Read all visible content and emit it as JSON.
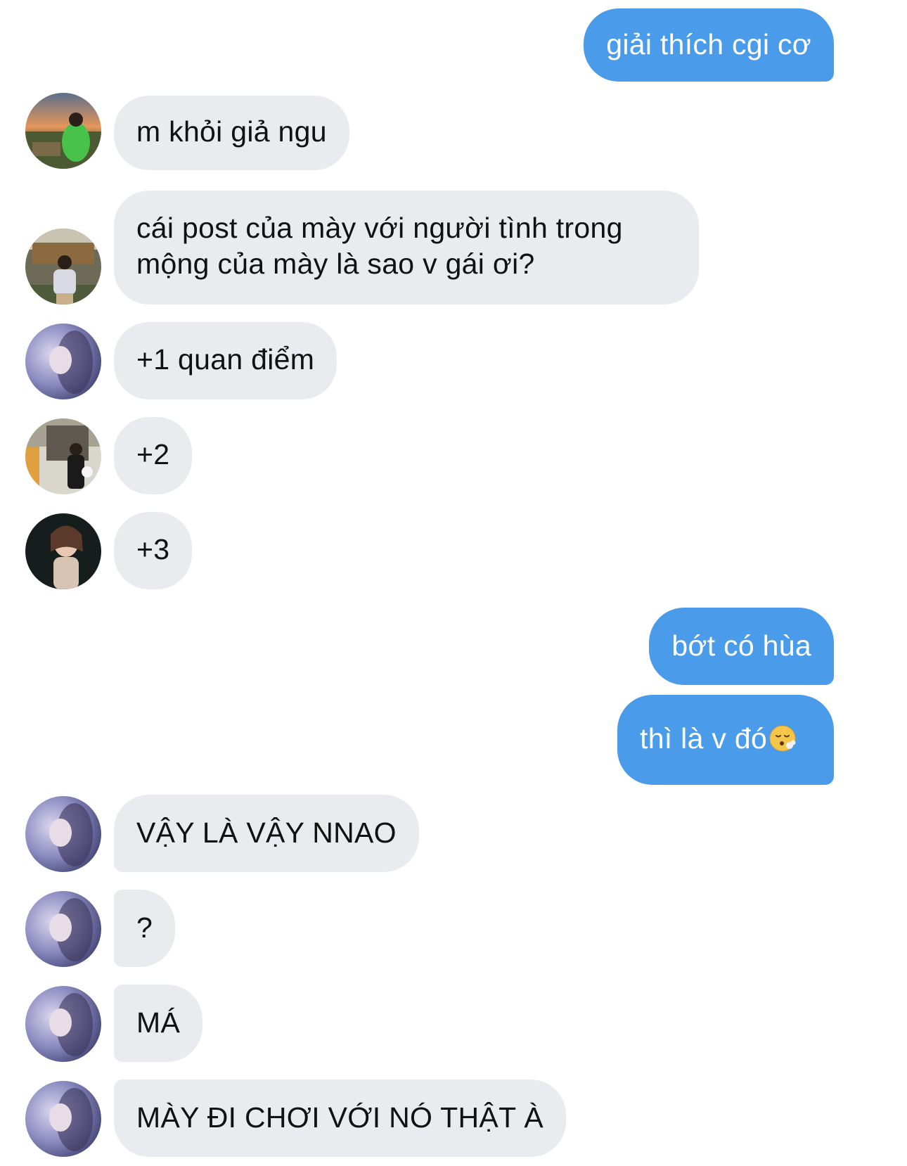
{
  "messages": {
    "m1": "giải thích cgi cơ",
    "m2": "m khỏi giả ngu",
    "m3": "cái post của mày với người tình trong mộng của mày là sao v gái ơi?",
    "m4": "+1 quan điểm",
    "m5": "+2",
    "m6": "+3",
    "m7": "bớt có hùa",
    "m8": "thì là v đó",
    "m9": "VẬY LÀ VẬY NNAO",
    "m10": "?",
    "m11": "MÁ",
    "m12": "MÀY ĐI CHƠI VỚI NÓ THẬT À"
  },
  "emoji": {
    "m8": "exhaling-face-icon"
  },
  "colors": {
    "outgoing_bubble": "#4a9be9",
    "incoming_bubble": "#e9ebef",
    "outgoing_text": "#ffffff",
    "incoming_text": "#111111"
  }
}
